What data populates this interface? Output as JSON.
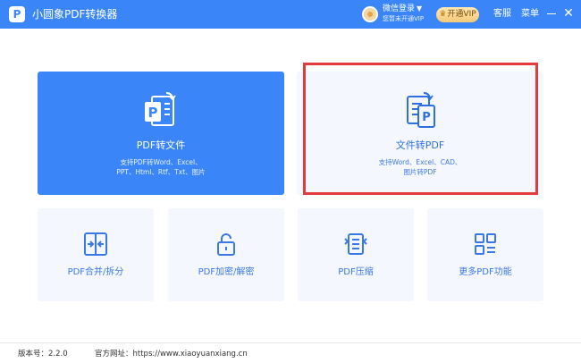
{
  "app": {
    "title": "小圆象PDF转换器",
    "logo_letter": "P"
  },
  "header": {
    "login_label": "微信登录",
    "vip_hint": "您暂未开通VIP",
    "vip_button": "开通VIP",
    "customer_service": "客服",
    "menu": "菜单",
    "close_glyph": "✕",
    "accent_color": "#3a86f8"
  },
  "cards": {
    "pdf_to_file": {
      "title": "PDF转文件",
      "desc_line1": "支持PDF转Word、Excel、",
      "desc_line2": "PPT、Html、Rtf、Txt、图片",
      "icon": "pdf-to-file-icon"
    },
    "file_to_pdf": {
      "title": "文件转PDF",
      "desc_line1": "支持Word、Excel、CAD、",
      "desc_line2": "图片转PDF",
      "icon": "file-to-pdf-icon"
    },
    "merge_split": {
      "label": "PDF合并/拆分",
      "icon": "merge-split-icon"
    },
    "encrypt_decrypt": {
      "label": "PDF加密/解密",
      "icon": "unlock-icon"
    },
    "compress": {
      "label": "PDF压缩",
      "icon": "compress-icon"
    },
    "more": {
      "label": "更多PDF功能",
      "icon": "grid-icon"
    }
  },
  "footer": {
    "version": "版本号：2.2.0",
    "website": "官方网址：https://www.xiaoyuanxiang.cn"
  },
  "colors": {
    "highlight": "#e33b3b"
  }
}
